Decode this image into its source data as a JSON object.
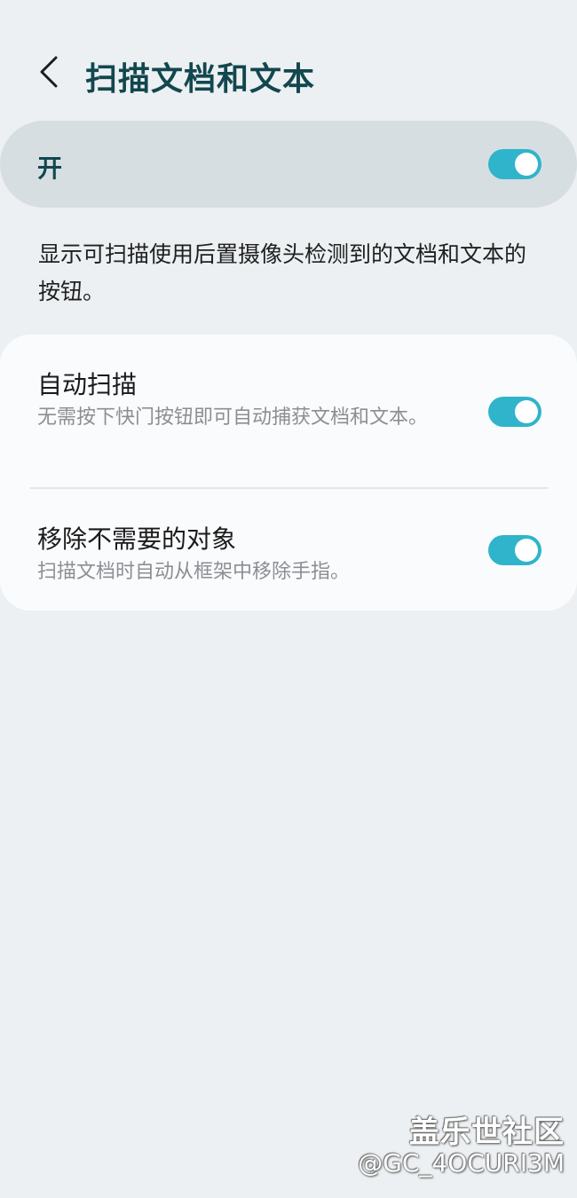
{
  "header": {
    "back_icon": "chevron-left-icon",
    "title": "扫描文档和文本"
  },
  "master": {
    "label": "开",
    "enabled": true
  },
  "description": "显示可扫描使用后置摄像头检测到的文档和文本的按钮。",
  "settings": [
    {
      "title": "自动扫描",
      "subtitle": "无需按下快门按钮即可自动捕获文档和文本。",
      "enabled": true
    },
    {
      "title": "移除不需要的对象",
      "subtitle": "扫描文档时自动从框架中移除手指。",
      "enabled": true
    }
  ],
  "watermark": {
    "title": "盖乐世社区",
    "handle": "@GC_4OCURI3M"
  },
  "colors": {
    "accent": "#2fb4cb",
    "title": "#12474f",
    "background": "#ecf0f2",
    "master_bar": "#d6dee2",
    "card": "#fafbfd"
  }
}
